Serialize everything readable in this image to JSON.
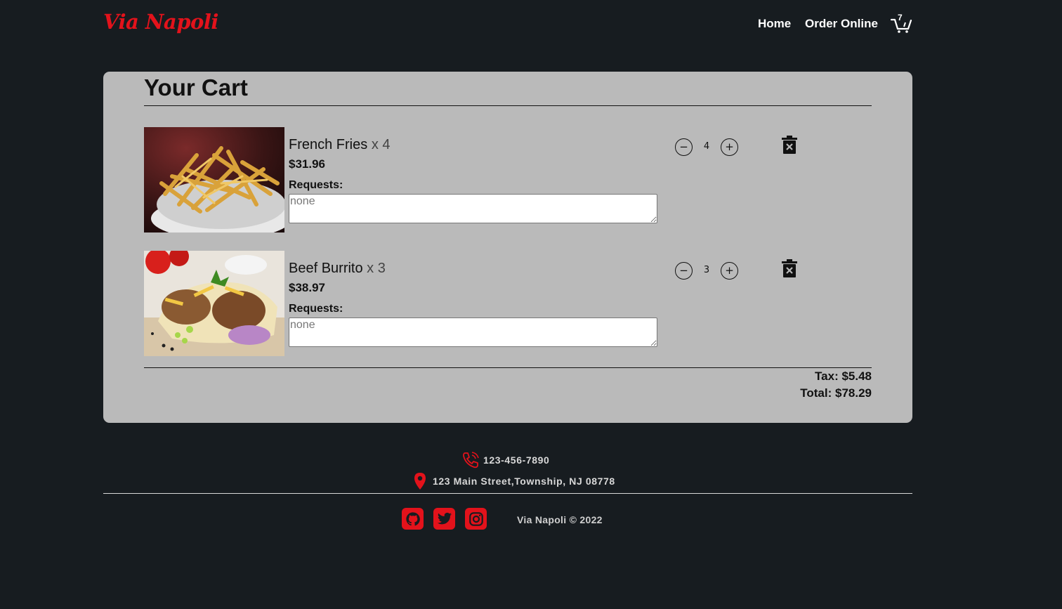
{
  "nav": {
    "brand": "Via Napoli",
    "home_label": "Home",
    "order_label": "Order Online",
    "cart_count": "7"
  },
  "cart": {
    "title": "Your Cart",
    "items": [
      {
        "name": "French Fries",
        "qty_text": "x 4",
        "price": "$31.96",
        "requests_label": "Requests:",
        "requests_placeholder": "none",
        "quantity": "4",
        "image_icon": "french-fries-photo"
      },
      {
        "name": "Beef Burrito",
        "qty_text": "x 3",
        "price": "$38.97",
        "requests_label": "Requests:",
        "requests_placeholder": "none",
        "quantity": "3",
        "image_icon": "beef-burrito-photo"
      }
    ],
    "minus_glyph": "−",
    "plus_glyph": "+",
    "tax": "Tax: $5.48",
    "total": "Total: $78.29"
  },
  "footer": {
    "phone": "123-456-7890",
    "address": "123 Main Street,Township, NJ 08778",
    "copyright": "Via Napoli © 2022",
    "social": [
      "github-icon",
      "twitter-icon",
      "instagram-icon"
    ]
  },
  "colors": {
    "background": "#171c20",
    "panel": "#bababa",
    "accent": "#e3121b"
  }
}
